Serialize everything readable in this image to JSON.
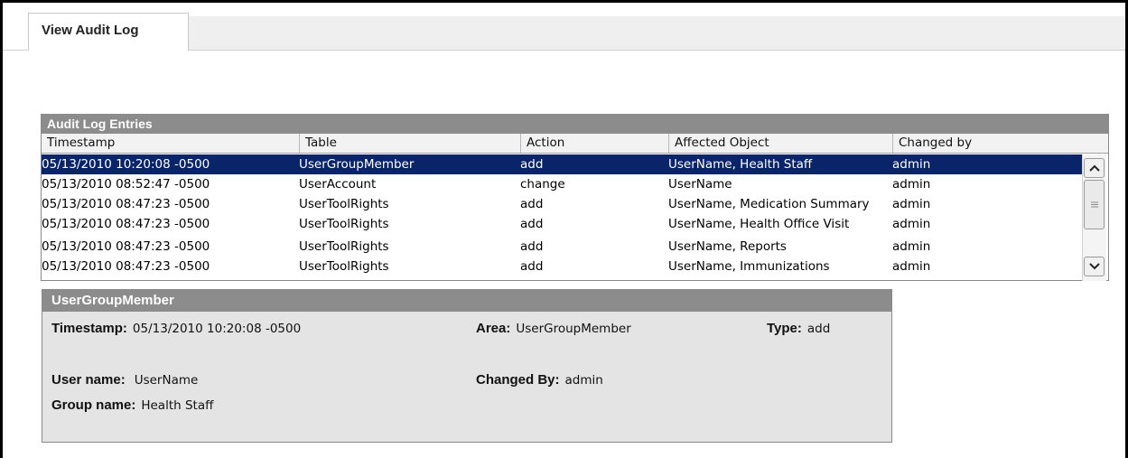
{
  "tabs": {
    "active_label": "View Audit Log"
  },
  "audit_log": {
    "title": "Audit Log Entries",
    "columns": [
      "Timestamp",
      "Table",
      "Action",
      "Affected Object",
      "Changed by"
    ],
    "rows": [
      [
        "05/13/2010 10:20:08 -0500",
        "UserGroupMember",
        "add",
        "UserName, Health Staff",
        "admin"
      ],
      [
        "05/13/2010 08:52:47 -0500",
        "UserAccount",
        "change",
        "UserName",
        "admin"
      ],
      [
        "05/13/2010 08:47:23 -0500",
        "UserToolRights",
        "add",
        "UserName, Medication Summary",
        "admin"
      ],
      [
        "05/13/2010 08:47:23 -0500",
        "UserToolRights",
        "add",
        "UserName, Health Office Visit",
        "admin"
      ],
      [
        "05/13/2010 08:47:23 -0500",
        "UserToolRights",
        "add",
        "UserName, Reports",
        "admin"
      ],
      [
        "05/13/2010 08:47:23 -0500",
        "UserToolRights",
        "add",
        "UserName, Immunizations",
        "admin"
      ]
    ],
    "selected_row": 0
  },
  "detail": {
    "title": "UserGroupMember",
    "timestamp_label": "Timestamp:",
    "timestamp_value": "05/13/2010 10:20:08 -0500",
    "area_label": "Area:",
    "area_value": "UserGroupMember",
    "type_label": "Type:",
    "type_value": "add",
    "user_name_label": "User name:",
    "user_name_value": "UserName",
    "changed_by_label": "Changed By:",
    "changed_by_value": "admin",
    "group_name_label": "Group name:",
    "group_name_value": "Health Staff"
  },
  "colors": {
    "selected_row": "#0a246a",
    "panel_header": "#8c8c8c",
    "detail_bg": "#e4e4e4"
  },
  "icons": {
    "scroll_up": "chevron-up-icon",
    "scroll_down": "chevron-down-icon",
    "thumb_grip": "grip-icon"
  }
}
